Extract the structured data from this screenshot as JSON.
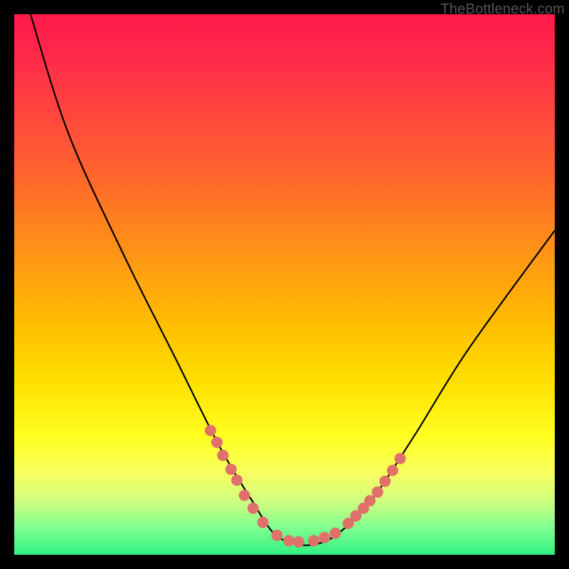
{
  "watermark": "TheBottleneck.com",
  "chart_data": {
    "type": "line",
    "title": "",
    "xlabel": "",
    "ylabel": "",
    "xlim": [
      0,
      100
    ],
    "ylim": [
      0,
      100
    ],
    "grid": false,
    "legend": false,
    "series": [
      {
        "name": "bottleneck-curve",
        "x": [
          3,
          10,
          20,
          30,
          38,
          44,
          48,
          52,
          56,
          60,
          66,
          74,
          84,
          100
        ],
        "values": [
          100,
          78,
          56,
          36,
          20,
          10,
          4,
          2,
          2,
          4,
          10,
          22,
          38,
          60
        ]
      }
    ],
    "markers": [
      {
        "name": "left-marker-1",
        "x": 36.3,
        "y": 23.0
      },
      {
        "name": "left-marker-2",
        "x": 37.5,
        "y": 20.8
      },
      {
        "name": "left-marker-3",
        "x": 38.6,
        "y": 18.4
      },
      {
        "name": "left-marker-4",
        "x": 40.1,
        "y": 15.8
      },
      {
        "name": "left-marker-5",
        "x": 41.2,
        "y": 13.8
      },
      {
        "name": "left-marker-6",
        "x": 42.6,
        "y": 11.0
      },
      {
        "name": "left-marker-7",
        "x": 44.2,
        "y": 8.6
      },
      {
        "name": "left-marker-8",
        "x": 46.0,
        "y": 6.0
      },
      {
        "name": "bottom-marker-1",
        "x": 48.6,
        "y": 3.6
      },
      {
        "name": "bottom-marker-2",
        "x": 50.8,
        "y": 2.6
      },
      {
        "name": "bottom-marker-3",
        "x": 52.6,
        "y": 2.4
      },
      {
        "name": "bottom-marker-4",
        "x": 55.4,
        "y": 2.6
      },
      {
        "name": "bottom-marker-5",
        "x": 57.4,
        "y": 3.2
      },
      {
        "name": "bottom-marker-6",
        "x": 59.4,
        "y": 4.0
      },
      {
        "name": "right-marker-1",
        "x": 61.8,
        "y": 5.8
      },
      {
        "name": "right-marker-2",
        "x": 63.2,
        "y": 7.2
      },
      {
        "name": "right-marker-3",
        "x": 64.6,
        "y": 8.6
      },
      {
        "name": "right-marker-4",
        "x": 65.8,
        "y": 10.0
      },
      {
        "name": "right-marker-5",
        "x": 67.2,
        "y": 11.6
      },
      {
        "name": "right-marker-6",
        "x": 68.6,
        "y": 13.6
      },
      {
        "name": "right-marker-7",
        "x": 70.0,
        "y": 15.6
      },
      {
        "name": "right-marker-8",
        "x": 71.4,
        "y": 17.8
      }
    ],
    "colors": {
      "curve": "#000000",
      "marker": "#e0716a",
      "gradient_top": "#ff1a4a",
      "gradient_bottom": "#30f080"
    }
  }
}
